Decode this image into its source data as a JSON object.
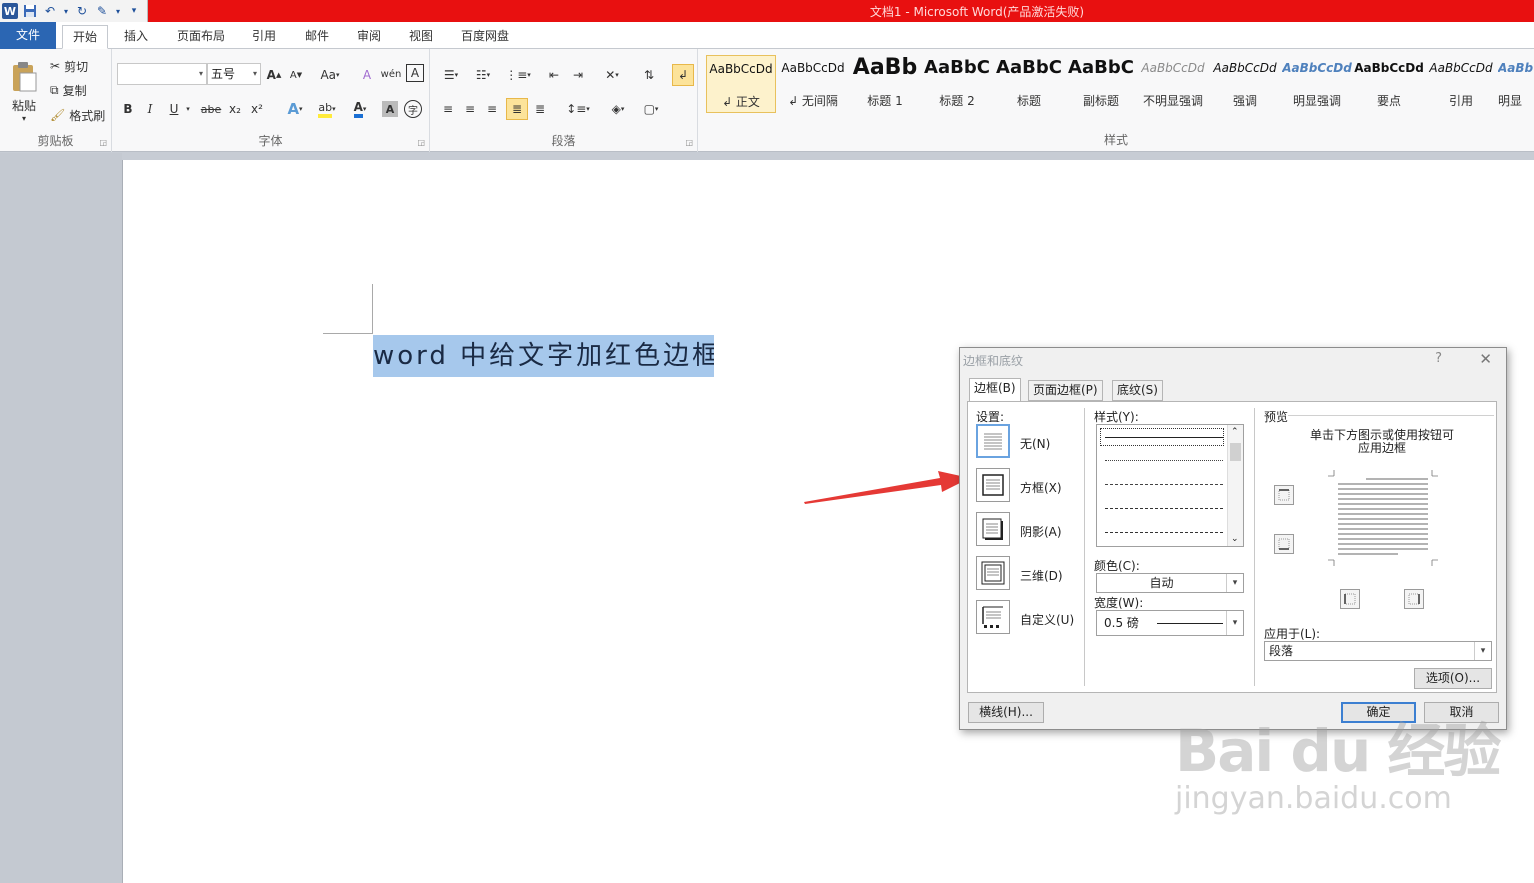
{
  "window": {
    "title": "文档1 - Microsoft Word(产品激活失败)"
  },
  "qat": {
    "word_icon": "W"
  },
  "tabs": [
    "文件",
    "开始",
    "插入",
    "页面布局",
    "引用",
    "邮件",
    "审阅",
    "视图",
    "百度网盘"
  ],
  "ribbon": {
    "clipboard": {
      "paste": "粘贴",
      "cut": "剪切",
      "copy": "复制",
      "format_painter": "格式刷",
      "label": "剪贴板"
    },
    "font": {
      "font_name": "",
      "font_size": "五号",
      "label": "字体",
      "bold": "B",
      "italic": "I",
      "underline": "U",
      "strike": "abe",
      "sub": "x₂",
      "sup": "x²",
      "grow": "A",
      "shrink": "A",
      "case": "Aa",
      "clear": "A",
      "pinyin": "wén",
      "char_border": "A"
    },
    "paragraph": {
      "label": "段落"
    },
    "styles": {
      "label": "样式",
      "items": [
        {
          "sample": "AaBbCcDd",
          "name": "↲ 正文"
        },
        {
          "sample": "AaBbCcDd",
          "name": "↲ 无间隔"
        },
        {
          "sample": "AaBb",
          "name": "标题 1"
        },
        {
          "sample": "AaBbC",
          "name": "标题 2"
        },
        {
          "sample": "AaBbC",
          "name": "标题"
        },
        {
          "sample": "AaBbC",
          "name": "副标题"
        },
        {
          "sample": "AaBbCcDd",
          "name": "不明显强调"
        },
        {
          "sample": "AaBbCcDd",
          "name": "强调"
        },
        {
          "sample": "AaBbCcDd",
          "name": "明显强调"
        },
        {
          "sample": "AaBbCcDd",
          "name": "要点"
        },
        {
          "sample": "AaBbCcDd",
          "name": "引用"
        },
        {
          "sample": "AaBb",
          "name": "明显"
        }
      ]
    }
  },
  "document": {
    "text": "word 中给文字加红色边框",
    "para_mark": "↵"
  },
  "dialog": {
    "title": "边框和底纹",
    "help": "?",
    "close": "✕",
    "tabs": [
      "边框(B)",
      "页面边框(P)",
      "底纹(S)"
    ],
    "settings_label": "设置:",
    "settings": [
      "无(N)",
      "方框(X)",
      "阴影(A)",
      "三维(D)",
      "自定义(U)"
    ],
    "style_label": "样式(Y):",
    "color_label": "颜色(C):",
    "color_value": "自动",
    "width_label": "宽度(W):",
    "width_value": "0.5 磅",
    "preview_label": "预览",
    "preview_hint_1": "单击下方图示或使用按钮可",
    "preview_hint_2": "应用边框",
    "apply_label": "应用于(L):",
    "apply_value": "段落",
    "options_button": "选项(O)...",
    "hline_button": "横线(H)...",
    "ok_button": "确定",
    "cancel_button": "取消"
  },
  "watermark": {
    "brand": "Bai du 经验",
    "url": "jingyan.baidu.com"
  },
  "colors": {
    "titlebar": "#e81010",
    "file_tab": "#2b66b3",
    "selection": "#a6c8ec",
    "arrow": "#e53935"
  }
}
